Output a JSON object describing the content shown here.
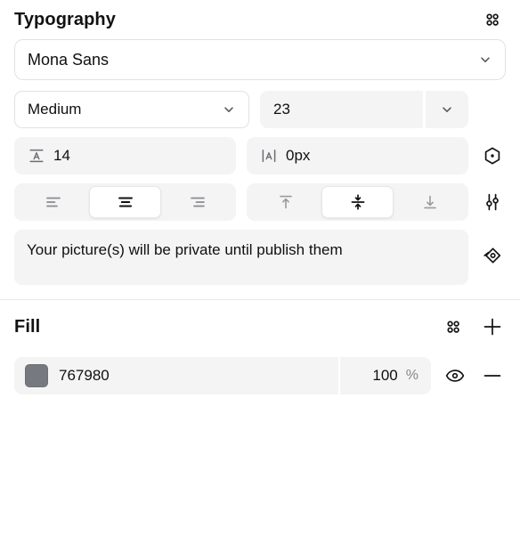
{
  "typography": {
    "title": "Typography",
    "header_icon": "grid-dots-icon",
    "font_family": {
      "value": "Mona Sans",
      "chevron": "chevron-down-icon"
    },
    "font_weight": {
      "value": "Medium",
      "chevron": "chevron-down-icon"
    },
    "font_size": {
      "value": "23",
      "chevron": "chevron-down-icon"
    },
    "line_height": {
      "icon": "line-height-icon",
      "value": "14"
    },
    "letter_spacing": {
      "icon": "letter-spacing-icon",
      "value": "0px"
    },
    "type_settings_icon": "hexagon-dot-icon",
    "horizontal_align": {
      "options": [
        "align-left",
        "align-center",
        "align-right"
      ],
      "selected": "align-center"
    },
    "vertical_align": {
      "options": [
        "align-top",
        "align-middle",
        "align-bottom"
      ],
      "selected": "align-middle"
    },
    "advanced_settings_icon": "sliders-icon",
    "content": {
      "text": "Your picture(s) will be private until publish them",
      "variable_icon": "variable-diamond-icon"
    }
  },
  "fill": {
    "title": "Fill",
    "header_icons": [
      "grid-dots-icon",
      "plus-icon"
    ],
    "layers": [
      {
        "swatch_color": "#767980",
        "hex": "767980",
        "opacity": "100",
        "opacity_unit": "%",
        "visibility_icon": "eye-icon",
        "remove_icon": "minus-icon"
      }
    ]
  }
}
